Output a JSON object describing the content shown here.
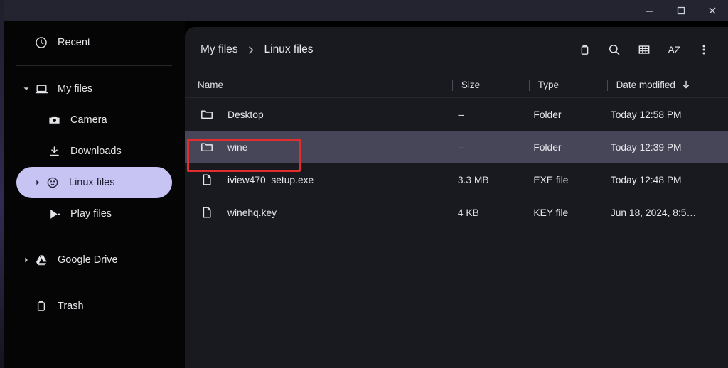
{
  "window": {
    "controls": [
      {
        "name": "minimize",
        "label": "Minimize"
      },
      {
        "name": "maximize",
        "label": "Maximize"
      },
      {
        "name": "close",
        "label": "Close"
      }
    ],
    "titlebar_color": "#23242f"
  },
  "sidebar": {
    "items": [
      {
        "label": "Recent",
        "icon": "clock-icon",
        "level": 0,
        "twisty": "",
        "selected": false
      },
      {
        "label": "My files",
        "icon": "laptop-icon",
        "level": 0,
        "twisty": "▾",
        "selected": false
      },
      {
        "label": "Camera",
        "icon": "camera-icon",
        "level": 1,
        "twisty": "",
        "selected": false
      },
      {
        "label": "Downloads",
        "icon": "download-icon",
        "level": 1,
        "twisty": "",
        "selected": false
      },
      {
        "label": "Linux files",
        "icon": "linux-tux-icon",
        "level": 1,
        "twisty": "▸",
        "selected": true
      },
      {
        "label": "Play files",
        "icon": "google-play-icon",
        "level": 1,
        "twisty": "",
        "selected": false
      },
      {
        "label": "Google Drive",
        "icon": "google-drive-icon",
        "level": 0,
        "twisty": "▸",
        "selected": false
      },
      {
        "label": "Trash",
        "icon": "trash-icon",
        "level": 0,
        "twisty": "",
        "selected": false
      }
    ],
    "selected_item": "Linux files",
    "selected_pill_color": "#c7c3f2"
  },
  "breadcrumb": {
    "root": "My files",
    "separator": "❯",
    "current": "Linux files"
  },
  "toolbar": {
    "buttons": [
      {
        "name": "delete-button",
        "icon": "trash-icon"
      },
      {
        "name": "search-button",
        "icon": "search-icon"
      },
      {
        "name": "view-grid-button",
        "icon": "grid-view-icon"
      },
      {
        "name": "sort-button",
        "icon": "az-sort-icon",
        "label": "AZ"
      },
      {
        "name": "more-button",
        "icon": "three-dot-menu-icon"
      }
    ]
  },
  "file_list": {
    "columns": [
      "Name",
      "Size",
      "Type",
      "Date modified"
    ],
    "sort_column": "Date modified",
    "sort_direction_glyph": "↓",
    "rows": [
      {
        "name": "Desktop",
        "size": "--",
        "type": "Folder",
        "date": "Today 12:58 PM",
        "icon": "folder-icon",
        "selected": false
      },
      {
        "name": "wine",
        "size": "--",
        "type": "Folder",
        "date": "Today 12:39 PM",
        "icon": "folder-icon",
        "selected": true
      },
      {
        "name": "iview470_setup.exe",
        "size": "3.3 MB",
        "type": "EXE file",
        "date": "Today 12:48 PM",
        "icon": "document-icon",
        "selected": false
      },
      {
        "name": "winehq.key",
        "size": "4 KB",
        "type": "KEY file",
        "date": "Jun 18, 2024, 8:5…",
        "icon": "document-icon",
        "selected": false
      }
    ],
    "selected_row": "wine",
    "selected_row_color": "#474658"
  },
  "annotation": {
    "color": "#e12d2d",
    "target": "wine"
  }
}
